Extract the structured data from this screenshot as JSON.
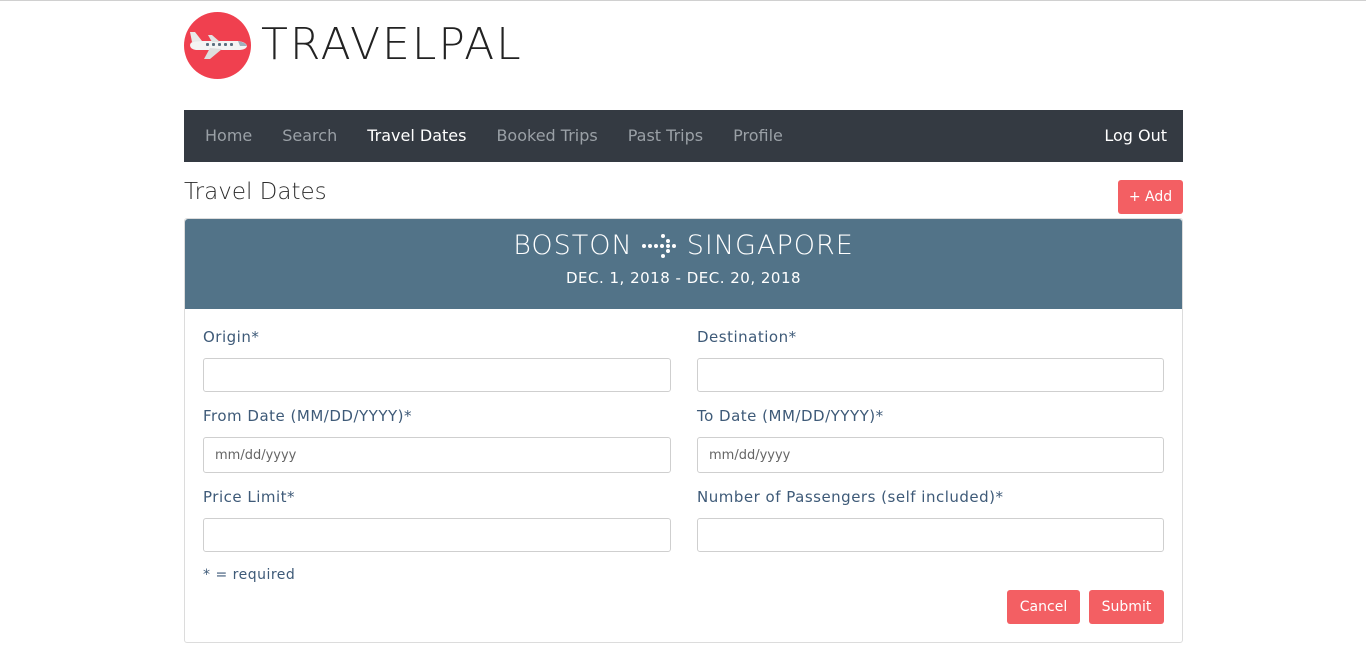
{
  "brand": {
    "name": "TRAVELPAL",
    "logo_icon": "airplane-icon",
    "logo_color": "#f0404f"
  },
  "nav": {
    "items": [
      {
        "label": "Home",
        "active": false
      },
      {
        "label": "Search",
        "active": false
      },
      {
        "label": "Travel Dates",
        "active": true
      },
      {
        "label": "Booked Trips",
        "active": false
      },
      {
        "label": "Past Trips",
        "active": false
      },
      {
        "label": "Profile",
        "active": false
      }
    ],
    "logout_label": "Log Out",
    "background": "#343a42"
  },
  "page": {
    "title": "Travel Dates",
    "add_label": "+ Add"
  },
  "trip": {
    "origin": "BOSTON",
    "destination": "SINGAPORE",
    "arrow_icon": "dotted-arrow-right-icon",
    "date_range": "DEC. 1, 2018 - DEC. 20, 2018",
    "header_color": "#527388"
  },
  "form": {
    "origin": {
      "label": "Origin*",
      "value": "",
      "placeholder": ""
    },
    "destination": {
      "label": "Destination*",
      "value": "",
      "placeholder": ""
    },
    "from_date": {
      "label": "From Date (MM/DD/YYYY)*",
      "value": "",
      "placeholder": "mm/dd/yyyy"
    },
    "to_date": {
      "label": "To Date (MM/DD/YYYY)*",
      "value": "",
      "placeholder": "mm/dd/yyyy"
    },
    "price_limit": {
      "label": "Price Limit*",
      "value": "",
      "placeholder": ""
    },
    "passengers": {
      "label": "Number of Passengers (self included)*",
      "value": "",
      "placeholder": ""
    },
    "required_note": "* = required",
    "cancel_label": "Cancel",
    "submit_label": "Submit"
  },
  "colors": {
    "accent": "#f35f63",
    "label": "#3e5a78"
  }
}
